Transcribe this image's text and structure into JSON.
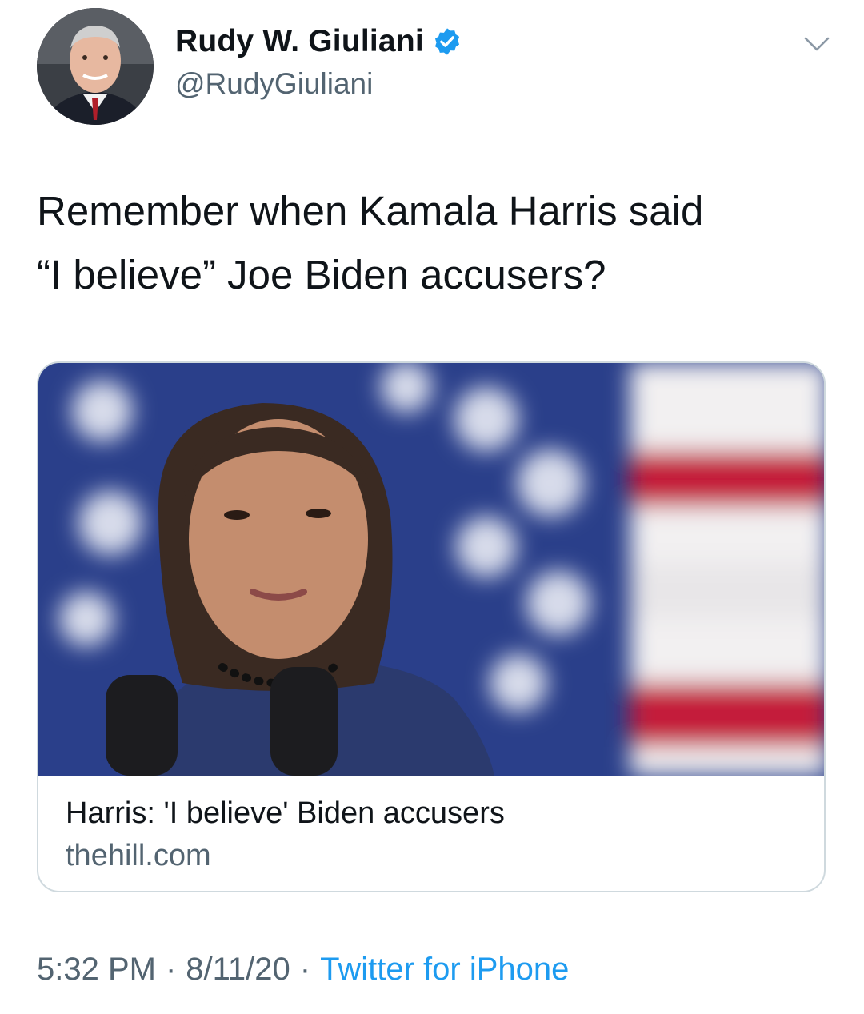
{
  "author": {
    "display_name": "Rudy W. Giuliani",
    "handle": "@RudyGiuliani",
    "verified": true,
    "verified_color": "#1d9bf0"
  },
  "tweet": {
    "text": "Remember when Kamala Harris said\n“I believe” Joe Biden accusers?"
  },
  "link_card": {
    "title": "Harris: 'I believe' Biden accusers",
    "domain": "thehill.com"
  },
  "meta": {
    "time": "5:32 PM",
    "separator": "·",
    "date": "8/11/20",
    "source": "Twitter for iPhone"
  },
  "colors": {
    "text_primary": "#0f1419",
    "text_secondary": "#536471",
    "link": "#1d9bf0",
    "card_border": "#cfd9de"
  }
}
